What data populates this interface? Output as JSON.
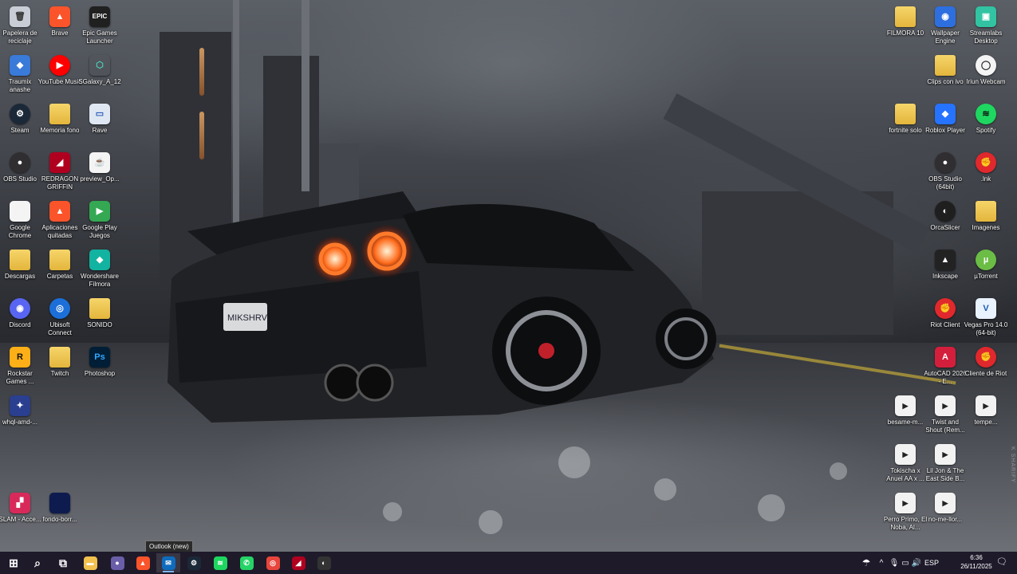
{
  "desktop_left": [
    {
      "name": "recycle-bin",
      "label": "Papelera de reciclaje",
      "glyph": "🗑",
      "bg": "#c9ced6",
      "color": "#333"
    },
    {
      "name": "brave",
      "label": "Brave",
      "glyph": "▲",
      "bg": "#fb542b"
    },
    {
      "name": "epic-games",
      "label": "Epic Games Launcher",
      "glyph": "EPIC",
      "bg": "#202020"
    },
    {
      "name": "traumix",
      "label": "Traumix anashe",
      "glyph": "◆",
      "bg": "#3a7ad8"
    },
    {
      "name": "youtube-music",
      "label": "YouTube Music",
      "glyph": "▶",
      "bg": "#ff0000",
      "round": true
    },
    {
      "name": "sgalaxy",
      "label": "SGalaxy_A_12",
      "glyph": "⬡",
      "bg": "transparent",
      "color": "#4fd1b6"
    },
    {
      "name": "steam",
      "label": "Steam",
      "glyph": "⚙",
      "bg": "#1b2838",
      "round": true
    },
    {
      "name": "memoria-fono",
      "label": "Memoria fono",
      "glyph": "",
      "bg": "folder"
    },
    {
      "name": "rave",
      "label": "Rave",
      "glyph": "▭",
      "bg": "#dfe7f3",
      "color": "#2a5db8"
    },
    {
      "name": "obs-studio",
      "label": "OBS Studio",
      "glyph": "●",
      "bg": "#302e31",
      "round": true
    },
    {
      "name": "redragon-griffin",
      "label": "REDRAGON GRIFFIN",
      "glyph": "◢",
      "bg": "#b00020"
    },
    {
      "name": "preview-op",
      "label": "preview_Op...",
      "glyph": "☕",
      "bg": "#f4f4f4",
      "color": "#d9531e"
    },
    {
      "name": "google-chrome",
      "label": "Google Chrome",
      "glyph": "",
      "bg": "#f4f4f4"
    },
    {
      "name": "aplicaciones-quitadas",
      "label": "Aplicaciones quitadas",
      "glyph": "▲",
      "bg": "#fb542b"
    },
    {
      "name": "google-play-juegos",
      "label": "Google Play Juegos",
      "glyph": "▶",
      "bg": "#34a853"
    },
    {
      "name": "descargas",
      "label": "Descargas",
      "glyph": "",
      "bg": "folder"
    },
    {
      "name": "carpetas",
      "label": "Carpetas",
      "glyph": "",
      "bg": "folder"
    },
    {
      "name": "wondershare-filmora",
      "label": "Wondershare Filmora",
      "glyph": "◆",
      "bg": "#12b3a0"
    },
    {
      "name": "discord",
      "label": "Discord",
      "glyph": "◉",
      "bg": "#5865f2",
      "round": true
    },
    {
      "name": "ubisoft-connect",
      "label": "Ubisoft Connect",
      "glyph": "◎",
      "bg": "#1c6fd8",
      "round": true
    },
    {
      "name": "sonido",
      "label": "SONIDO",
      "glyph": "",
      "bg": "folder"
    },
    {
      "name": "rockstar-games",
      "label": "Rockstar Games ...",
      "glyph": "R",
      "bg": "#fcaf17",
      "color": "#111"
    },
    {
      "name": "twitch",
      "label": "Twitch",
      "glyph": "",
      "bg": "folder"
    },
    {
      "name": "photoshop",
      "label": "Photoshop",
      "glyph": "Ps",
      "bg": "#001e36",
      "color": "#31a8ff"
    },
    {
      "name": "whql-amd",
      "label": "whql-amd-...",
      "glyph": "✦",
      "bg": "#2a3f8f"
    },
    {
      "name": "slam-acce",
      "label": "SLAM - Acce...",
      "glyph": "▞",
      "bg": "#d82a5a"
    },
    {
      "name": "fondo-borr",
      "label": "fondo-borr...",
      "glyph": "",
      "bg": "#0d1b4f"
    }
  ],
  "desktop_right": [
    {
      "name": "filmora-10",
      "label": "FILMORA 10",
      "glyph": "",
      "bg": "folder"
    },
    {
      "name": "wallpaper-engine",
      "label": "Wallpaper Engine",
      "glyph": "◉",
      "bg": "#2e6fe0"
    },
    {
      "name": "streamlabs-desktop",
      "label": "Streamlabs Desktop",
      "glyph": "▣",
      "bg": "#31c3a2"
    },
    {
      "name": "clips-con-ivo",
      "label": "Clips con ivo",
      "glyph": "",
      "bg": "folder"
    },
    {
      "name": "iriun-webcam",
      "label": "Iriun Webcam",
      "glyph": "◯",
      "bg": "#f4f4f4",
      "color": "#222",
      "round": true
    },
    {
      "name": "fortnite-solo",
      "label": "fortnite solo",
      "glyph": "",
      "bg": "folder"
    },
    {
      "name": "roblox-player",
      "label": "Roblox Player",
      "glyph": "◆",
      "bg": "#2673ff"
    },
    {
      "name": "spotify",
      "label": "Spotify",
      "glyph": "≋",
      "bg": "#1ed760",
      "color": "#111",
      "round": true
    },
    {
      "name": "obs-studio-64",
      "label": "OBS Studio (64bit)",
      "glyph": "●",
      "bg": "#302e31",
      "round": true
    },
    {
      "name": "lnk",
      "label": ".lnk",
      "glyph": "✊",
      "bg": "#e0282d",
      "round": true
    },
    {
      "name": "orcaslicer",
      "label": "OrcaSlicer",
      "glyph": "◐",
      "bg": "#1f1f1f",
      "round": true
    },
    {
      "name": "imagenes",
      "label": "Imagenes",
      "glyph": "",
      "bg": "folder"
    },
    {
      "name": "inkscape",
      "label": "Inkscape",
      "glyph": "▲",
      "bg": "#222"
    },
    {
      "name": "utorrent",
      "label": "µTorrent",
      "glyph": "µ",
      "bg": "#6bbd45",
      "round": true
    },
    {
      "name": "riot-client",
      "label": "Riot Client",
      "glyph": "✊",
      "bg": "#e0282d",
      "round": true
    },
    {
      "name": "vegas-pro",
      "label": "Vegas Pro 14.0 (64-bit)",
      "glyph": "V",
      "bg": "#e9f2ff",
      "color": "#1a5db0"
    },
    {
      "name": "autocad",
      "label": "AutoCAD 2026 - E...",
      "glyph": "A",
      "bg": "#d41f3c"
    },
    {
      "name": "cliente-de-riot",
      "label": "Cliente de Riot",
      "glyph": "✊",
      "bg": "#e0282d",
      "round": true
    },
    {
      "name": "besame-media",
      "label": "besame-m...",
      "glyph": "▶",
      "bg": "media"
    },
    {
      "name": "twist-and-shout",
      "label": "Twist and Shout (Rem...",
      "glyph": "▶",
      "bg": "media"
    },
    {
      "name": "tempe-media",
      "label": "tempe...",
      "glyph": "▶",
      "bg": "media"
    },
    {
      "name": "tokischa-media",
      "label": "Tokischa x Anuel AA x ...",
      "glyph": "▶",
      "bg": "media"
    },
    {
      "name": "lil-jon-media",
      "label": "Lil Jon & The East Side B...",
      "glyph": "▶",
      "bg": "media"
    },
    {
      "name": "perro-primo-media",
      "label": "Perro Primo, El Noba, Al...",
      "glyph": "▶",
      "bg": "media"
    },
    {
      "name": "no-me-llor-media",
      "label": "no-me-llor...",
      "glyph": "▶",
      "bg": "media"
    }
  ],
  "taskbar": {
    "tooltip": "Outlook (new)",
    "apps": [
      {
        "name": "start",
        "glyph": "⊞",
        "bg": "transparent"
      },
      {
        "name": "search",
        "glyph": "⌕",
        "bg": "transparent"
      },
      {
        "name": "task-view",
        "glyph": "⧉",
        "bg": "transparent"
      },
      {
        "name": "file-explorer",
        "glyph": "▬",
        "bg": "#f2c14e"
      },
      {
        "name": "obs",
        "glyph": "●",
        "bg": "#6b5ea8"
      },
      {
        "name": "brave",
        "glyph": "▲",
        "bg": "#fb542b"
      },
      {
        "name": "outlook",
        "glyph": "✉",
        "bg": "#0f6cbd",
        "active": true
      },
      {
        "name": "steam",
        "glyph": "⚙",
        "bg": "#1b2838"
      },
      {
        "name": "spotify",
        "glyph": "≋",
        "bg": "#1ed760"
      },
      {
        "name": "whatsapp",
        "glyph": "✆",
        "bg": "#25d366"
      },
      {
        "name": "chrome",
        "glyph": "◎",
        "bg": "#e8453c"
      },
      {
        "name": "redragon",
        "glyph": "◢",
        "bg": "#b00020"
      },
      {
        "name": "orcaslicer",
        "glyph": "◐",
        "bg": "#333"
      }
    ],
    "tray_lang": "ESP",
    "time": "6:36",
    "date": "26/11/2025"
  },
  "watermark": "K SHARIFY"
}
